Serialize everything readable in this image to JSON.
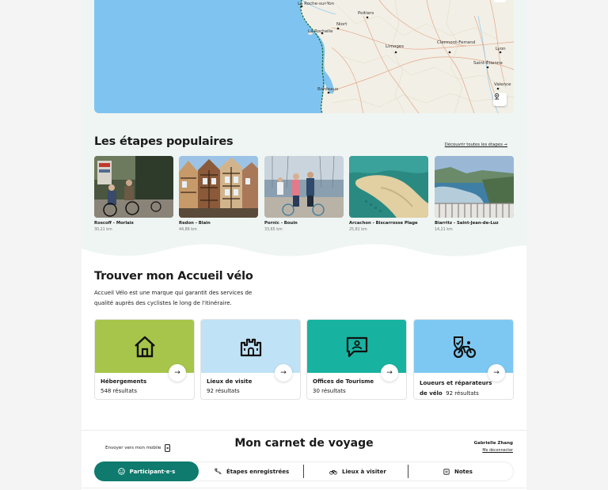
{
  "map": {
    "cities": [
      {
        "name": "La Roche-sur-Yon"
      },
      {
        "name": "Poitiers"
      },
      {
        "name": "Niort"
      },
      {
        "name": "La Rochelle"
      },
      {
        "name": "Limoges"
      },
      {
        "name": "Clermont-Ferrand"
      },
      {
        "name": "Lyon"
      },
      {
        "name": "Saint-Étienne"
      },
      {
        "name": "Valence"
      },
      {
        "name": "Bordeaux"
      }
    ],
    "locate_icon": "location-icon"
  },
  "popular": {
    "title": "Les étapes populaires",
    "link": "Découvrir toutes les étapes →",
    "stages": [
      {
        "name": "Roscoff - Morlaix",
        "distance": "30,21 km"
      },
      {
        "name": "Redon - Blain",
        "distance": "44,86 km"
      },
      {
        "name": "Pornic - Bouin",
        "distance": "33,65 km"
      },
      {
        "name": "Arcachon - Biscarrosse Plage",
        "distance": "25,81 km"
      },
      {
        "name": "Biarritz - Saint-Jean-de-Luz",
        "distance": "14,21 km"
      }
    ]
  },
  "accueil": {
    "title": "Trouver mon Accueil vélo",
    "description": "Accueil Vélo est une marque qui garantit des services de qualité auprès des cyclistes le long de l'itinéraire.",
    "cards": [
      {
        "title": "Hébergements",
        "count": "548 résultats",
        "color": "#a6c54a",
        "icon": "house-icon"
      },
      {
        "title": "Lieux de visite",
        "count": "92 résultats",
        "color": "#bfe2f6",
        "icon": "castle-icon"
      },
      {
        "title": "Offices de Tourisme",
        "count": "30 résultats",
        "color": "#17b3a0",
        "icon": "info-board-icon"
      },
      {
        "title": "Loueurs et réparateurs de vélo",
        "title_line1": "Loueurs et réparateurs",
        "title_line2": "de vélo",
        "count": "92 résultats",
        "color": "#7dc8f2",
        "icon": "bike-repair-icon"
      }
    ]
  },
  "carnet": {
    "send_label": "Envoyer vers mon mobile",
    "title": "Mon carnet de voyage",
    "user_name": "Gabrielle Zhang",
    "logout": "Me déconnecter",
    "tabs": [
      {
        "label": "Participant·e·s",
        "active": true
      },
      {
        "label": "Étapes enregistrées"
      },
      {
        "label": "Lieux à visiter"
      },
      {
        "label": "Notes"
      }
    ]
  }
}
